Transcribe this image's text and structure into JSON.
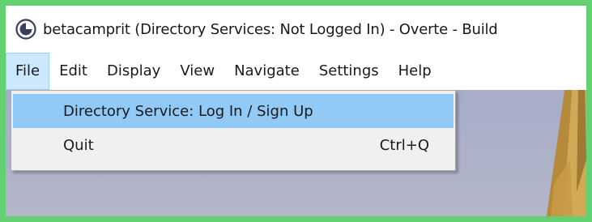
{
  "window": {
    "title": "betacamprit (Directory Services: Not Logged In) - Overte - Build"
  },
  "menubar": {
    "items": [
      {
        "label": "File"
      },
      {
        "label": "Edit"
      },
      {
        "label": "Display"
      },
      {
        "label": "View"
      },
      {
        "label": "Navigate"
      },
      {
        "label": "Settings"
      },
      {
        "label": "Help"
      }
    ]
  },
  "file_menu": {
    "items": [
      {
        "label": "Directory Service: Log In / Sign Up",
        "shortcut": ""
      },
      {
        "label": "Quit",
        "shortcut": "Ctrl+Q"
      }
    ]
  },
  "icons": {
    "app": "overte-logo-icon"
  },
  "colors": {
    "frame": "#63d171",
    "menu_highlight": "#91c9f7",
    "active_menu": "#cce8ff"
  }
}
